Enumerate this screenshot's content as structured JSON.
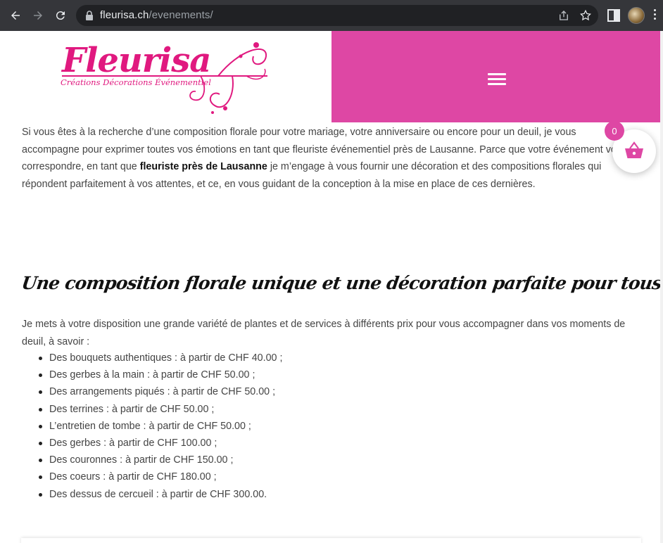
{
  "browser": {
    "url_domain": "fleurisa.ch",
    "url_path": "/evenements/"
  },
  "header": {
    "logo_text": "Fleurisa",
    "logo_tagline": "Créations Décorations Événementiel",
    "accent_color": "#de47a4"
  },
  "cart": {
    "count": "0"
  },
  "intro": {
    "text_before": "Si vous êtes à la recherche d’une composition florale pour votre mariage, votre anniversaire ou encore pour un deuil, je vous accompagne pour exprimer toutes vos émotions en tant que fleuriste événementiel près de Lausanne. Parce que votre événement vous correspondre, en tant que ",
    "bold": "fleuriste près de Lausanne",
    "text_after": " je m’engage à vous fournir une décoration et des compositions florales qui répondent parfaitement à vos attentes, et ce, en vous guidant de la conception à la mise en place de ces dernières."
  },
  "section": {
    "title": "Une composition florale unique et une décoration parfaite pour tous vos événements",
    "paragraph": "Je mets à votre disposition une grande variété de plantes et de services à différents prix pour vous accompagner dans vos moments de deuil, à savoir :",
    "services": [
      "Des bouquets authentiques : à partir de CHF 40.00 ;",
      "Des gerbes à la main : à partir de CHF 50.00 ;",
      "Des arrangements piqués : à partir de CHF 50.00 ;",
      "Des terrines : à partir de CHF 50.00 ;",
      "L’entretien de tombe : à partir de CHF 50.00 ;",
      "Des gerbes : à partir de CHF 100.00 ;",
      "Des couronnes : à partir de CHF 150.00 ;",
      "Des coeurs : à partir de CHF 180.00 ;",
      "Des dessus de cercueil : à partir de CHF 300.00."
    ]
  }
}
